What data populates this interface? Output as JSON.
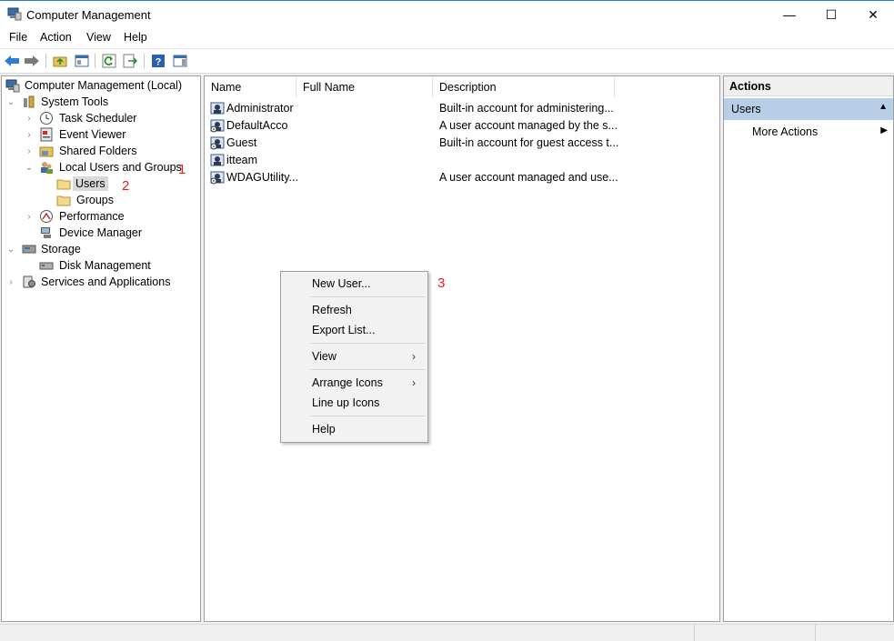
{
  "window": {
    "title": "Computer Management",
    "min": "—",
    "max": "☐",
    "close": "✕"
  },
  "menu": {
    "file": "File",
    "action": "Action",
    "view": "View",
    "help": "Help"
  },
  "tree": {
    "root": "Computer Management (Local)",
    "system_tools": "System Tools",
    "task_scheduler": "Task Scheduler",
    "event_viewer": "Event Viewer",
    "shared_folders": "Shared Folders",
    "local_users": "Local Users and Groups",
    "users": "Users",
    "groups": "Groups",
    "performance": "Performance",
    "device_manager": "Device Manager",
    "storage": "Storage",
    "disk_management": "Disk Management",
    "services": "Services and Applications"
  },
  "annotations": {
    "a1": "1",
    "a2": "2",
    "a3": "3"
  },
  "list": {
    "columns": {
      "name": "Name",
      "full_name": "Full Name",
      "description": "Description"
    },
    "rows": [
      {
        "name": "Administrator",
        "full_name": "",
        "description": "Built-in account for administering..."
      },
      {
        "name": "DefaultAcco",
        "full_name": "",
        "description": "A user account managed by the s..."
      },
      {
        "name": "Guest",
        "full_name": "",
        "description": "Built-in account for guest access t..."
      },
      {
        "name": "itteam",
        "full_name": "",
        "description": ""
      },
      {
        "name": "WDAGUtility...",
        "full_name": "",
        "description": "A user account managed and use..."
      }
    ]
  },
  "actions": {
    "header": "Actions",
    "section": "Users",
    "more": "More Actions"
  },
  "context_menu": {
    "new_user": "New User...",
    "refresh": "Refresh",
    "export_list": "Export List...",
    "view": "View",
    "arrange_icons": "Arrange Icons",
    "line_up_icons": "Line up Icons",
    "help": "Help"
  },
  "colors": {
    "accent": "#1f7fcf",
    "selection": "#b7cee6",
    "annotation": "#e0201b"
  }
}
